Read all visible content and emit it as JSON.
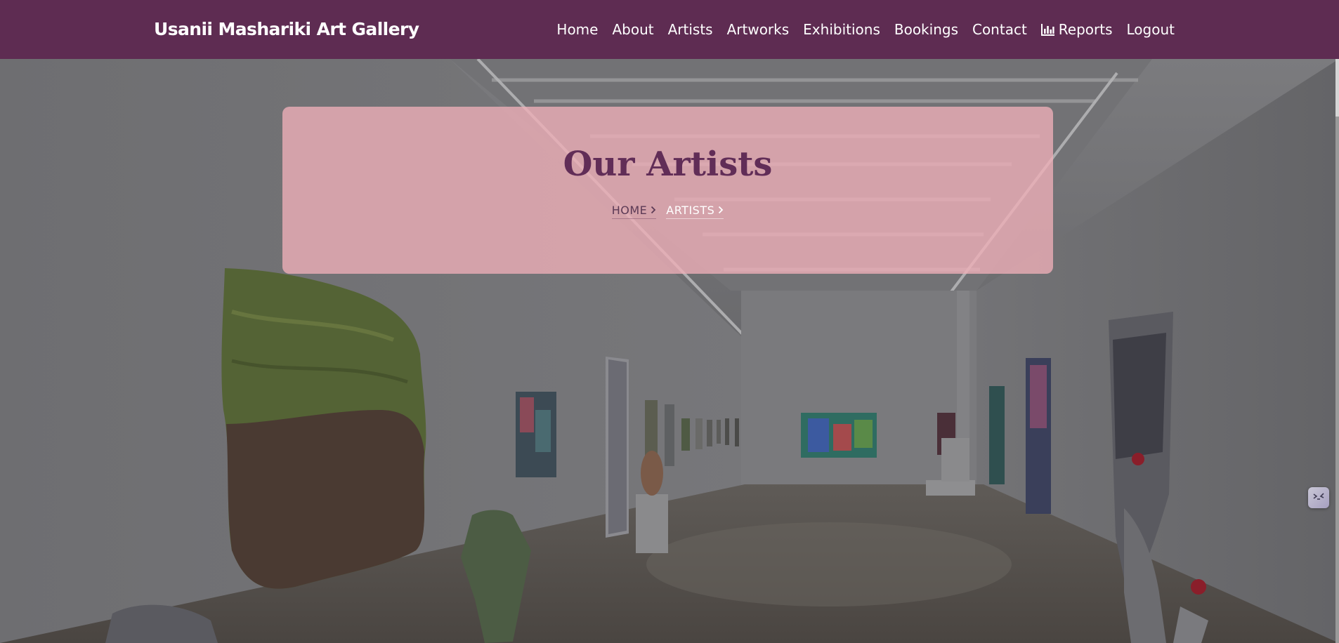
{
  "navbar": {
    "brand": "Usanii Mashariki Art Gallery",
    "items": [
      {
        "label": "Home"
      },
      {
        "label": "About"
      },
      {
        "label": "Artists"
      },
      {
        "label": "Artworks"
      },
      {
        "label": "Exhibitions"
      },
      {
        "label": "Bookings"
      },
      {
        "label": "Contact"
      },
      {
        "label": "Reports",
        "icon": "bar-chart-icon"
      },
      {
        "label": "Logout"
      }
    ]
  },
  "hero": {
    "title": "Our Artists",
    "breadcrumb": [
      {
        "label": "HOME",
        "icon": "chevron-right-icon"
      },
      {
        "label": "ARTISTS",
        "icon": "chevron-right-icon"
      }
    ]
  },
  "colors": {
    "navbar": "#5e2c52",
    "title": "#612d57",
    "card": "#f0b0b8"
  }
}
